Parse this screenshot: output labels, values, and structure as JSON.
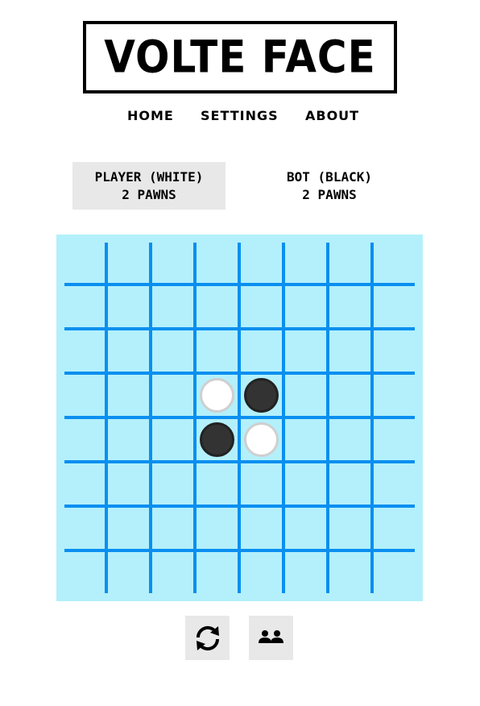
{
  "title": "VOLTE FACE",
  "nav": {
    "home": "HOME",
    "settings": "SETTINGS",
    "about": "ABOUT"
  },
  "players": {
    "player": {
      "label": "PLAYER (WHITE)",
      "pawns": "2 PAWNS",
      "active": true
    },
    "bot": {
      "label": "BOT (BLACK)",
      "pawns": "2 PAWNS",
      "active": false
    }
  },
  "board": {
    "size": 8,
    "colors": {
      "background": "#b3f0fb",
      "grid": "#0a8ff0",
      "white_piece": "#ffffff",
      "white_piece_border": "#cfcfcf",
      "black_piece": "#333333",
      "black_piece_border": "#222222"
    },
    "pieces": [
      {
        "row": 3,
        "col": 3,
        "color": "white"
      },
      {
        "row": 3,
        "col": 4,
        "color": "black"
      },
      {
        "row": 4,
        "col": 3,
        "color": "black"
      },
      {
        "row": 4,
        "col": 4,
        "color": "white"
      }
    ]
  },
  "controls": {
    "restart_icon": "restart-arrows-icon",
    "mode_icon": "two-players-icon"
  }
}
